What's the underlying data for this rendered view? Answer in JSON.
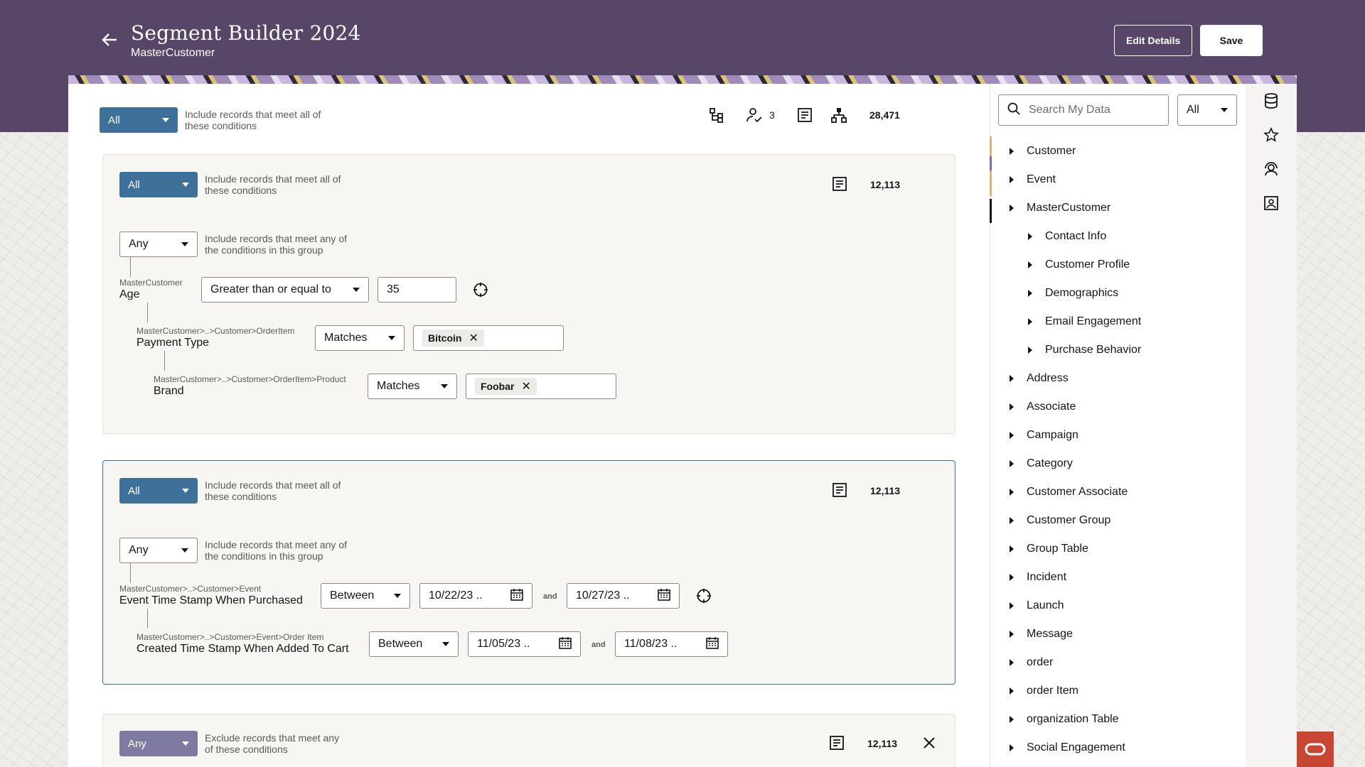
{
  "header": {
    "title": "Segment Builder 2024",
    "subtitle": "MasterCustomer",
    "edit_details_label": "Edit Details",
    "save_label": "Save"
  },
  "top_condition": {
    "mode": "All",
    "hint": "Include records that meet all of these conditions",
    "people_count": "3",
    "total_count": "28,471"
  },
  "groups": [
    {
      "mode": "All",
      "hint": "Include records that meet all of these conditions",
      "count": "12,113",
      "subgroup_mode": "Any",
      "subgroup_hint": "Include records that meet any of the conditions in this group",
      "conditions": [
        {
          "path": "MasterCustomer",
          "attribute": "Age",
          "operator": "Greater than or equal to",
          "value": "35"
        },
        {
          "path": "MasterCustomer>..>Customer>OrderItem",
          "attribute": "Payment Type",
          "operator": "Matches",
          "chip": "Bitcoin"
        },
        {
          "path": "MasterCustomer>..>Customer>OrderItem>Product",
          "attribute": "Brand",
          "operator": "Matches",
          "chip": "Foobar"
        }
      ]
    },
    {
      "mode": "All",
      "hint": "Include records that meet all of these conditions",
      "count": "12,113",
      "subgroup_mode": "Any",
      "subgroup_hint": "Include records that meet any of the conditions in this group",
      "conditions": [
        {
          "path": "MasterCustomer>..>Customer>Event",
          "attribute": "Event Time Stamp When Purchased",
          "operator": "Between",
          "from": "10/22/23 ..",
          "and": "and",
          "to": "10/27/23 .."
        },
        {
          "path": "MasterCustomer>..>Customer>Event>Order Item",
          "attribute": "Created Time Stamp When Added To Cart",
          "operator": "Between",
          "from": "11/05/23 ..",
          "and": "and",
          "to": "11/08/23 .."
        }
      ]
    },
    {
      "mode": "Any",
      "hint": "Exclude records that meet any of these conditions",
      "count": "12,113"
    }
  ],
  "data_panel": {
    "search_placeholder": "Search My Data",
    "filter_value": "All",
    "tree": [
      {
        "label": "Customer",
        "level": 0
      },
      {
        "label": "Event",
        "level": 0
      },
      {
        "label": "MasterCustomer",
        "level": 0
      },
      {
        "label": "Contact Info",
        "level": 1
      },
      {
        "label": "Customer Profile",
        "level": 1
      },
      {
        "label": "Demographics",
        "level": 1
      },
      {
        "label": "Email Engagement",
        "level": 1
      },
      {
        "label": "Purchase Behavior",
        "level": 1
      },
      {
        "label": "Address",
        "level": 0
      },
      {
        "label": "Associate",
        "level": 0
      },
      {
        "label": "Campaign",
        "level": 0
      },
      {
        "label": "Category",
        "level": 0
      },
      {
        "label": "Customer Associate",
        "level": 0
      },
      {
        "label": "Customer Group",
        "level": 0
      },
      {
        "label": "Group Table",
        "level": 0
      },
      {
        "label": "Incident",
        "level": 0
      },
      {
        "label": "Launch",
        "level": 0
      },
      {
        "label": "Message",
        "level": 0
      },
      {
        "label": "order",
        "level": 0
      },
      {
        "label": "order Item",
        "level": 0
      },
      {
        "label": "organization Table",
        "level": 0
      },
      {
        "label": "Social Engagement",
        "level": 0
      }
    ]
  },
  "colors": {
    "header_bg": "#574668",
    "primary_select": "#3d7199",
    "muted_select": "#7f7aa2",
    "oracle_red": "#c74634"
  }
}
